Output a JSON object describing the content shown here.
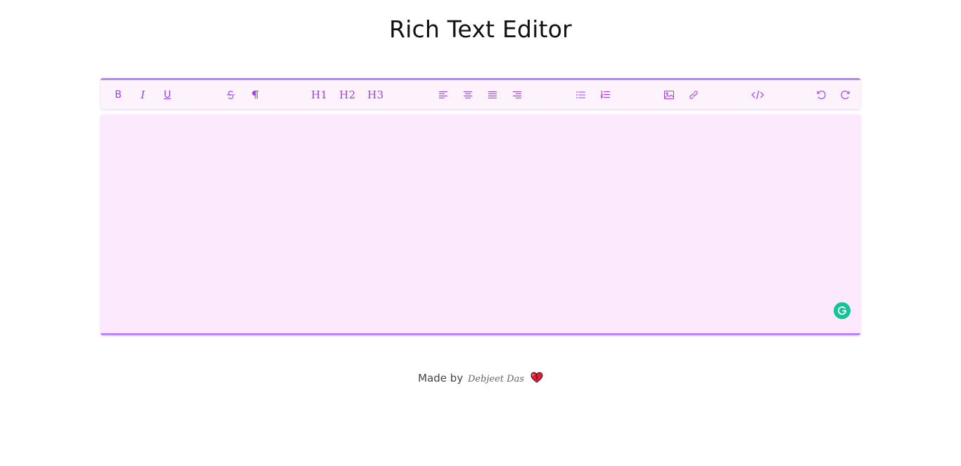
{
  "page": {
    "title": "Rich Text Editor"
  },
  "toolbar": {
    "bold": "B",
    "italic": "I",
    "underline": "U",
    "h1": "H1",
    "h2": "H2",
    "h3": "H3",
    "icons": {
      "strikethrough": "strikethrough-icon",
      "paragraph": "paragraph-icon",
      "align_left": "align-left-icon",
      "align_center": "align-center-icon",
      "align_justify": "align-justify-icon",
      "align_right": "align-right-icon",
      "bullet_list": "bullet-list-icon",
      "numbered_list": "numbered-list-icon",
      "image": "image-icon",
      "link": "link-icon",
      "code": "code-icon",
      "undo": "undo-icon",
      "redo": "redo-icon"
    }
  },
  "editor": {
    "content": "",
    "grammarly_icon": "grammarly-icon"
  },
  "footer": {
    "made_by": "Made by",
    "author": "Debjeet Das",
    "heart_icon": "heart-icon"
  },
  "colors": {
    "accent": "#a737ec",
    "border_accent": "#b983ff",
    "editor_bg": "#fde9fd",
    "toolbar_bg": "#fdf3fd",
    "grammarly": "#15c39a"
  }
}
